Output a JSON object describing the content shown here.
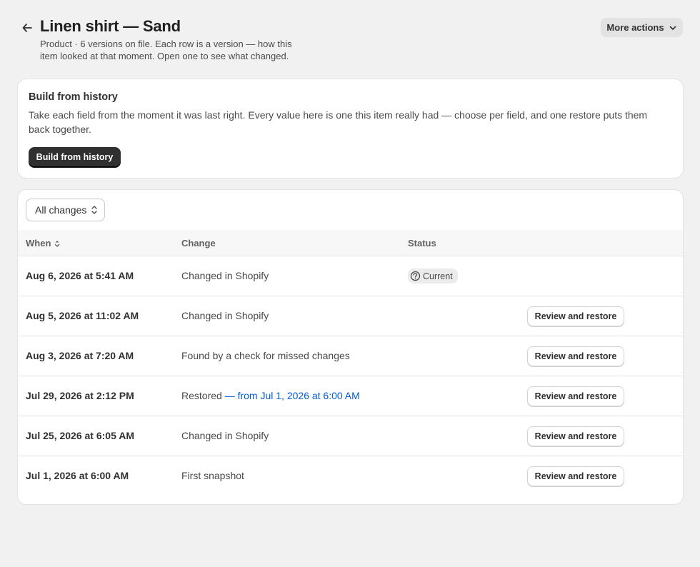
{
  "header": {
    "title": "Linen shirt — Sand",
    "subtitle": "Product · 6 versions on file. Each row is a version — how this item looked at that moment. Open one to see what changed.",
    "more_actions_label": "More actions"
  },
  "history_card": {
    "heading": "Build from history",
    "description": "Take each field from the moment it was last right. Every value here is one this item really had — choose per field, and one restore puts them back together.",
    "button_label": "Build from history"
  },
  "table": {
    "filter_label": "All changes",
    "columns": {
      "when": "When",
      "change": "Change",
      "status": "Status"
    },
    "rows": [
      {
        "when": "Aug 6, 2026 at 5:41 AM",
        "change": "Changed in Shopify",
        "status": "Current"
      },
      {
        "when": "Aug 5, 2026 at 11:02 AM",
        "change": "Changed in Shopify",
        "action": "Review and restore"
      },
      {
        "when": "Aug 3, 2026 at 7:20 AM",
        "change": "Found by a check for missed changes",
        "action": "Review and restore"
      },
      {
        "when": "Jul 29, 2026 at 2:12 PM",
        "change": "Restored",
        "change_link": "— from Jul 1, 2026 at 6:00 AM",
        "action": "Review and restore"
      },
      {
        "when": "Jul 25, 2026 at 6:05 AM",
        "change": "Changed in Shopify",
        "action": "Review and restore"
      },
      {
        "when": "Jul 1, 2026 at 6:00 AM",
        "change": "First snapshot",
        "action": "Review and restore"
      }
    ]
  }
}
